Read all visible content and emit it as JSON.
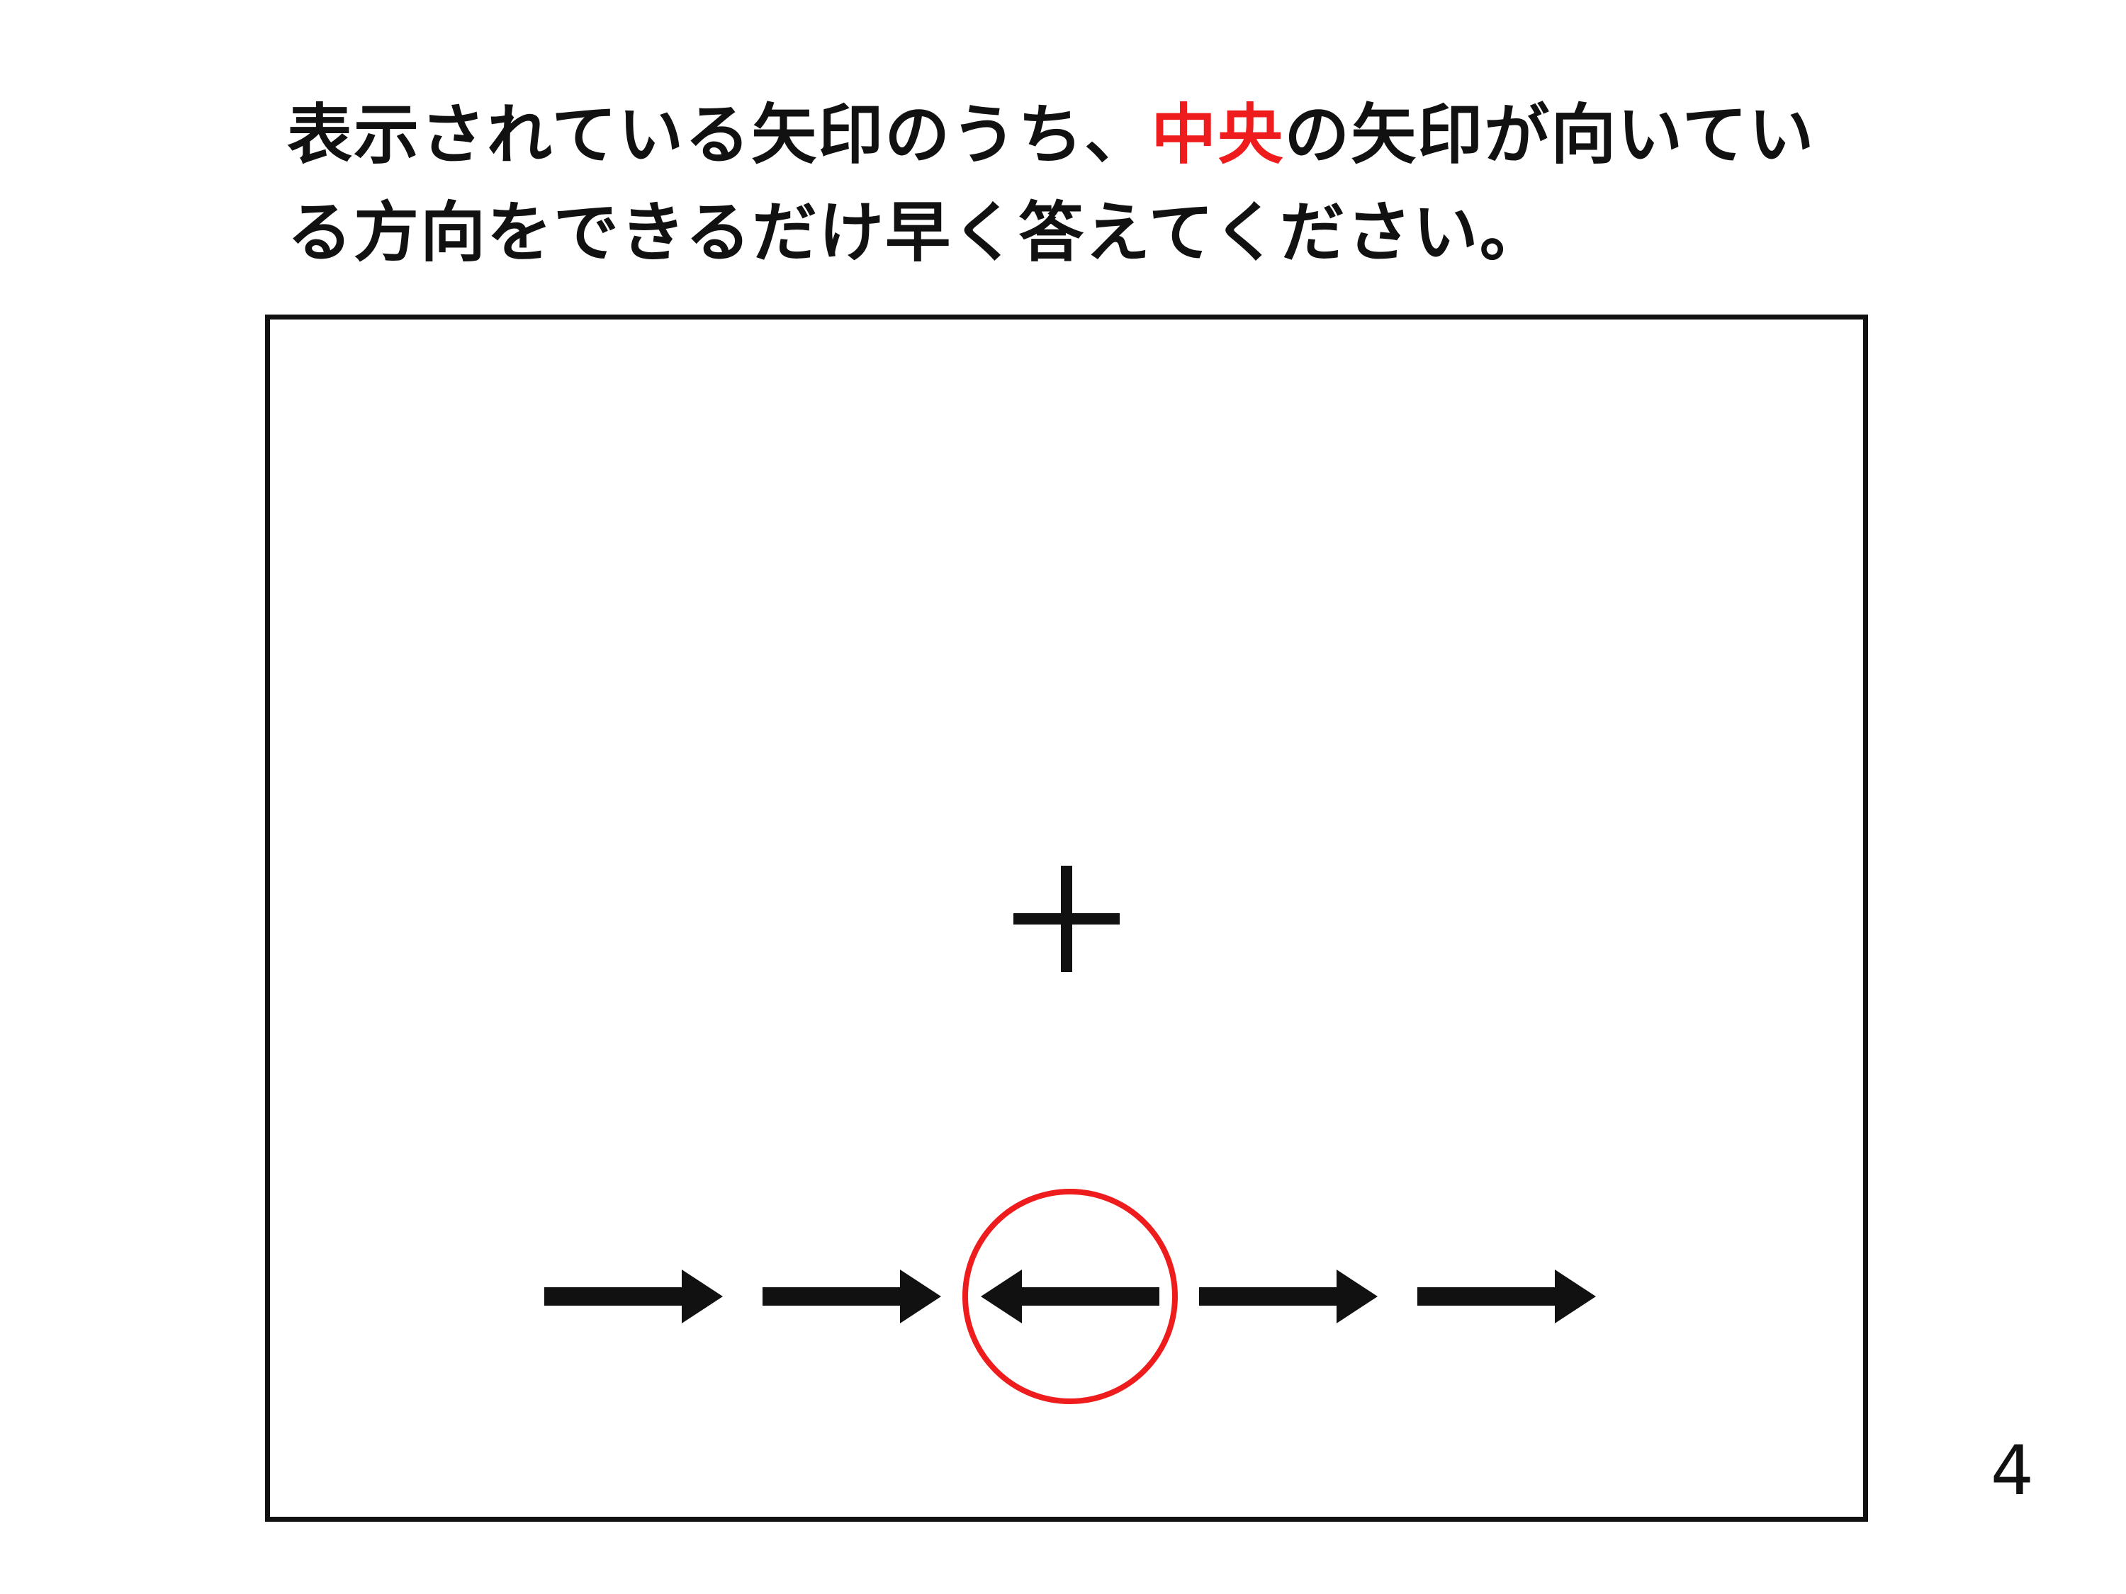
{
  "instruction": {
    "line1_before": "表示されている矢印のうち、",
    "line1_highlight": "中央",
    "line1_after": "の矢印が向いてい",
    "line2": "る方向をできるだけ早く答えてください。",
    "highlight_color": "#ee1c1c"
  },
  "stimulus": {
    "fixation": "+",
    "arrows": [
      "right",
      "right",
      "left",
      "right",
      "right"
    ],
    "target_index": 2,
    "target_marker_color": "#ee1c1c"
  },
  "page_number": "4"
}
